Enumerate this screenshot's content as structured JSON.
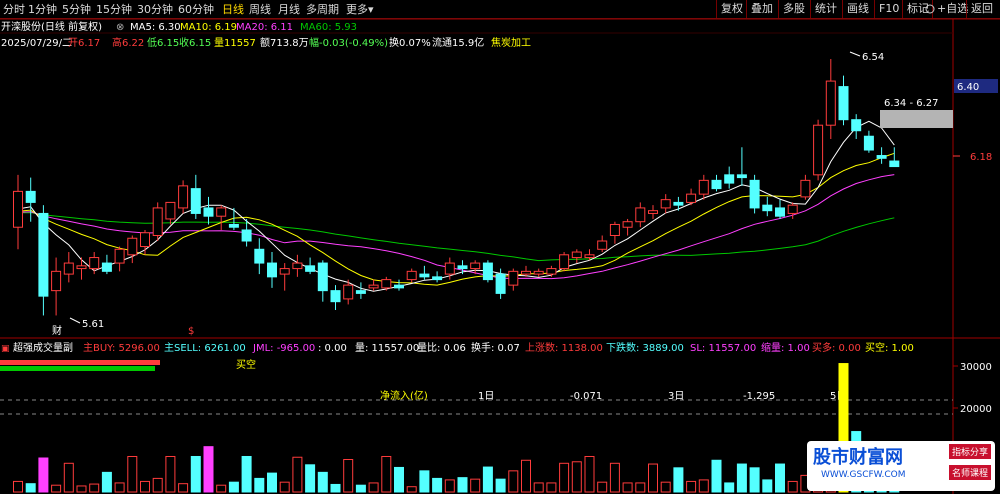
{
  "toolbar": {
    "timeframes": [
      "分时",
      "1分钟",
      "5分钟",
      "15分钟",
      "30分钟",
      "60分钟",
      "日线",
      "周线",
      "月线",
      "多周期",
      "更多"
    ],
    "active_index": 6,
    "more_arrow": "▾",
    "right_buttons": [
      "复权",
      "叠加",
      "多股",
      "统计",
      "画线",
      "F10",
      "标记",
      "+自选",
      "返回"
    ],
    "settings_icon": "gear-icon"
  },
  "header": {
    "stock": "开滦股份(日线 前复权)",
    "close_icon": "close-icon",
    "ma5": "MA5: 6.30",
    "ma10": "MA10: 6.19",
    "ma20": "MA20: 6.11",
    "ma60": "MA60: 5.93",
    "date": "2025/07/29/二",
    "open": "开6.17",
    "high": "高6.22",
    "low": "低6.15",
    "close": "收6.15",
    "volume": "量11557",
    "amount": "额713.8万",
    "change": "幅-0.03(-0.49%)",
    "turnover": "换0.07%",
    "float": "流通15.9亿",
    "industry": "焦炭加工"
  },
  "colors": {
    "up": "#ff3c3c",
    "down": "#54ffff",
    "ma5": "#ffffff",
    "ma10": "#ffff00",
    "ma20": "#ff40ff",
    "ma60": "#00c800",
    "axis": "#a00000",
    "price_tag": "#1e2a80"
  },
  "price_axis": {
    "labels": [
      "6.40",
      "6.18"
    ],
    "current_tag": "6.40"
  },
  "main_annotations": {
    "high": "6.54",
    "low": "5.61",
    "range": "6.34 - 6.27",
    "marker_cai": "财",
    "marker_s": "$"
  },
  "chart_data": {
    "type": "candlestick",
    "series": [
      {
        "name": "K线",
        "ohlc": [
          [
            5.93,
            6.12,
            5.85,
            6.06
          ],
          [
            6.06,
            6.11,
            5.95,
            6.02
          ],
          [
            5.98,
            6.01,
            5.61,
            5.68
          ],
          [
            5.7,
            5.82,
            5.61,
            5.77
          ],
          [
            5.76,
            5.84,
            5.73,
            5.8
          ],
          [
            5.78,
            5.82,
            5.74,
            5.79
          ],
          [
            5.78,
            5.84,
            5.76,
            5.82
          ],
          [
            5.8,
            5.83,
            5.76,
            5.77
          ],
          [
            5.8,
            5.86,
            5.77,
            5.85
          ],
          [
            5.83,
            5.9,
            5.8,
            5.89
          ],
          [
            5.86,
            5.92,
            5.83,
            5.91
          ],
          [
            5.9,
            6.02,
            5.88,
            6.0
          ],
          [
            5.96,
            6.02,
            5.94,
            6.02
          ],
          [
            6.0,
            6.1,
            5.98,
            6.08
          ],
          [
            6.07,
            6.12,
            5.96,
            5.98
          ],
          [
            6.0,
            6.04,
            5.94,
            5.97
          ],
          [
            5.97,
            6.01,
            5.92,
            6.0
          ],
          [
            5.94,
            6.0,
            5.92,
            5.93
          ],
          [
            5.92,
            5.96,
            5.86,
            5.88
          ],
          [
            5.85,
            5.89,
            5.76,
            5.8
          ],
          [
            5.8,
            5.84,
            5.71,
            5.75
          ],
          [
            5.76,
            5.8,
            5.7,
            5.78
          ],
          [
            5.78,
            5.83,
            5.75,
            5.8
          ],
          [
            5.79,
            5.82,
            5.76,
            5.77
          ],
          [
            5.8,
            5.81,
            5.66,
            5.7
          ],
          [
            5.7,
            5.72,
            5.63,
            5.66
          ],
          [
            5.67,
            5.74,
            5.65,
            5.72
          ],
          [
            5.7,
            5.73,
            5.67,
            5.69
          ],
          [
            5.71,
            5.74,
            5.7,
            5.72
          ],
          [
            5.71,
            5.75,
            5.7,
            5.74
          ],
          [
            5.72,
            5.74,
            5.7,
            5.71
          ],
          [
            5.74,
            5.78,
            5.73,
            5.77
          ],
          [
            5.76,
            5.79,
            5.74,
            5.75
          ],
          [
            5.75,
            5.77,
            5.73,
            5.74
          ],
          [
            5.76,
            5.82,
            5.74,
            5.8
          ],
          [
            5.79,
            5.81,
            5.76,
            5.78
          ],
          [
            5.78,
            5.81,
            5.76,
            5.8
          ],
          [
            5.8,
            5.81,
            5.73,
            5.74
          ],
          [
            5.76,
            5.78,
            5.67,
            5.69
          ],
          [
            5.72,
            5.78,
            5.7,
            5.77
          ],
          [
            5.76,
            5.79,
            5.75,
            5.77
          ],
          [
            5.76,
            5.78,
            5.75,
            5.77
          ],
          [
            5.76,
            5.79,
            5.75,
            5.78
          ],
          [
            5.78,
            5.84,
            5.77,
            5.83
          ],
          [
            5.82,
            5.85,
            5.8,
            5.84
          ],
          [
            5.82,
            5.85,
            5.81,
            5.83
          ],
          [
            5.85,
            5.9,
            5.84,
            5.88
          ],
          [
            5.9,
            5.95,
            5.87,
            5.94
          ],
          [
            5.93,
            5.96,
            5.9,
            5.95
          ],
          [
            5.95,
            6.02,
            5.93,
            6.0
          ],
          [
            5.98,
            6.01,
            5.96,
            5.99
          ],
          [
            6.0,
            6.05,
            5.98,
            6.03
          ],
          [
            6.02,
            6.04,
            5.99,
            6.01
          ],
          [
            6.02,
            6.07,
            6.01,
            6.05
          ],
          [
            6.05,
            6.12,
            6.03,
            6.1
          ],
          [
            6.1,
            6.12,
            6.06,
            6.07
          ],
          [
            6.12,
            6.15,
            6.07,
            6.09
          ],
          [
            6.12,
            6.22,
            6.08,
            6.11
          ],
          [
            6.1,
            6.12,
            5.98,
            6.0
          ],
          [
            6.01,
            6.04,
            5.97,
            5.99
          ],
          [
            6.0,
            6.03,
            5.96,
            5.97
          ],
          [
            5.98,
            6.02,
            5.96,
            6.01
          ],
          [
            6.04,
            6.12,
            6.03,
            6.1
          ],
          [
            6.12,
            6.32,
            6.1,
            6.3
          ],
          [
            6.3,
            6.54,
            6.25,
            6.46
          ],
          [
            6.44,
            6.48,
            6.3,
            6.32
          ],
          [
            6.32,
            6.34,
            6.25,
            6.28
          ],
          [
            6.26,
            6.28,
            6.2,
            6.21
          ],
          [
            6.19,
            6.22,
            6.16,
            6.18
          ],
          [
            6.17,
            6.22,
            6.15,
            6.15
          ]
        ]
      }
    ],
    "ma_series": [
      "MA5",
      "MA10",
      "MA20",
      "MA60"
    ],
    "ylim": [
      5.55,
      6.58
    ]
  },
  "sub": {
    "title": "超强成交量副",
    "items": [
      {
        "text": "主BUY: 5296.00",
        "color": "#ff3c3c"
      },
      {
        "text": "主SELL: 6261.00",
        "color": "#54ffff"
      },
      {
        "text": "JML: -965.00",
        "color": "#ff40ff"
      },
      {
        "text": ": 0.00",
        "color": "#ffffff"
      },
      {
        "text": "量: 11557.00",
        "color": "#ffffff"
      },
      {
        "text": "量比: 0.06",
        "color": "#ffffff"
      },
      {
        "text": "换手: 0.07",
        "color": "#ffffff"
      },
      {
        "text": "上涨数: 1138.00",
        "color": "#ff3c3c"
      },
      {
        "text": "下跌数: 3889.00",
        "color": "#54ffff"
      },
      {
        "text": "SL: 11557.00",
        "color": "#ff40ff"
      },
      {
        "text": "缩量: 1.00",
        "color": "#ff40ff"
      },
      {
        "text": "买多: 0.00",
        "color": "#ff3c3c"
      },
      {
        "text": "买空: 1.00",
        "color": "#ffff00"
      }
    ],
    "buy_sell_label": "买空",
    "net_label": "净流入(亿)",
    "d1": "1日",
    "v1": "-0.071",
    "d3": "3日",
    "v3": "-1.295",
    "d5": "5日",
    "axis_labels": [
      "30000",
      "20000"
    ],
    "volumes": [
      2800,
      2200,
      9000,
      1800,
      7600,
      1600,
      2100,
      5200,
      2400,
      9400,
      2800,
      3600,
      9400,
      2200,
      9400,
      12000,
      1800,
      2600,
      9400,
      3600,
      5000,
      2600,
      9200,
      7200,
      5200,
      2000,
      8600,
      1800,
      2400,
      9400,
      6500,
      1400,
      5600,
      3600,
      3200,
      3800,
      3400,
      6600,
      3400,
      5600,
      8400,
      2400,
      2400,
      7600,
      8000,
      9400,
      2600,
      7600,
      2400,
      2400,
      7400,
      2600,
      6400,
      2800,
      3200,
      8400,
      2400,
      7400,
      6400,
      3200,
      7400,
      2800,
      4400,
      8800,
      2600,
      34000,
      16000,
      7000,
      4800,
      7600
    ]
  },
  "brand": {
    "main": "股市财富网",
    "url": "WWW.GSCFW.COM",
    "tag1": "指标分享",
    "tag2": "名师课程"
  }
}
